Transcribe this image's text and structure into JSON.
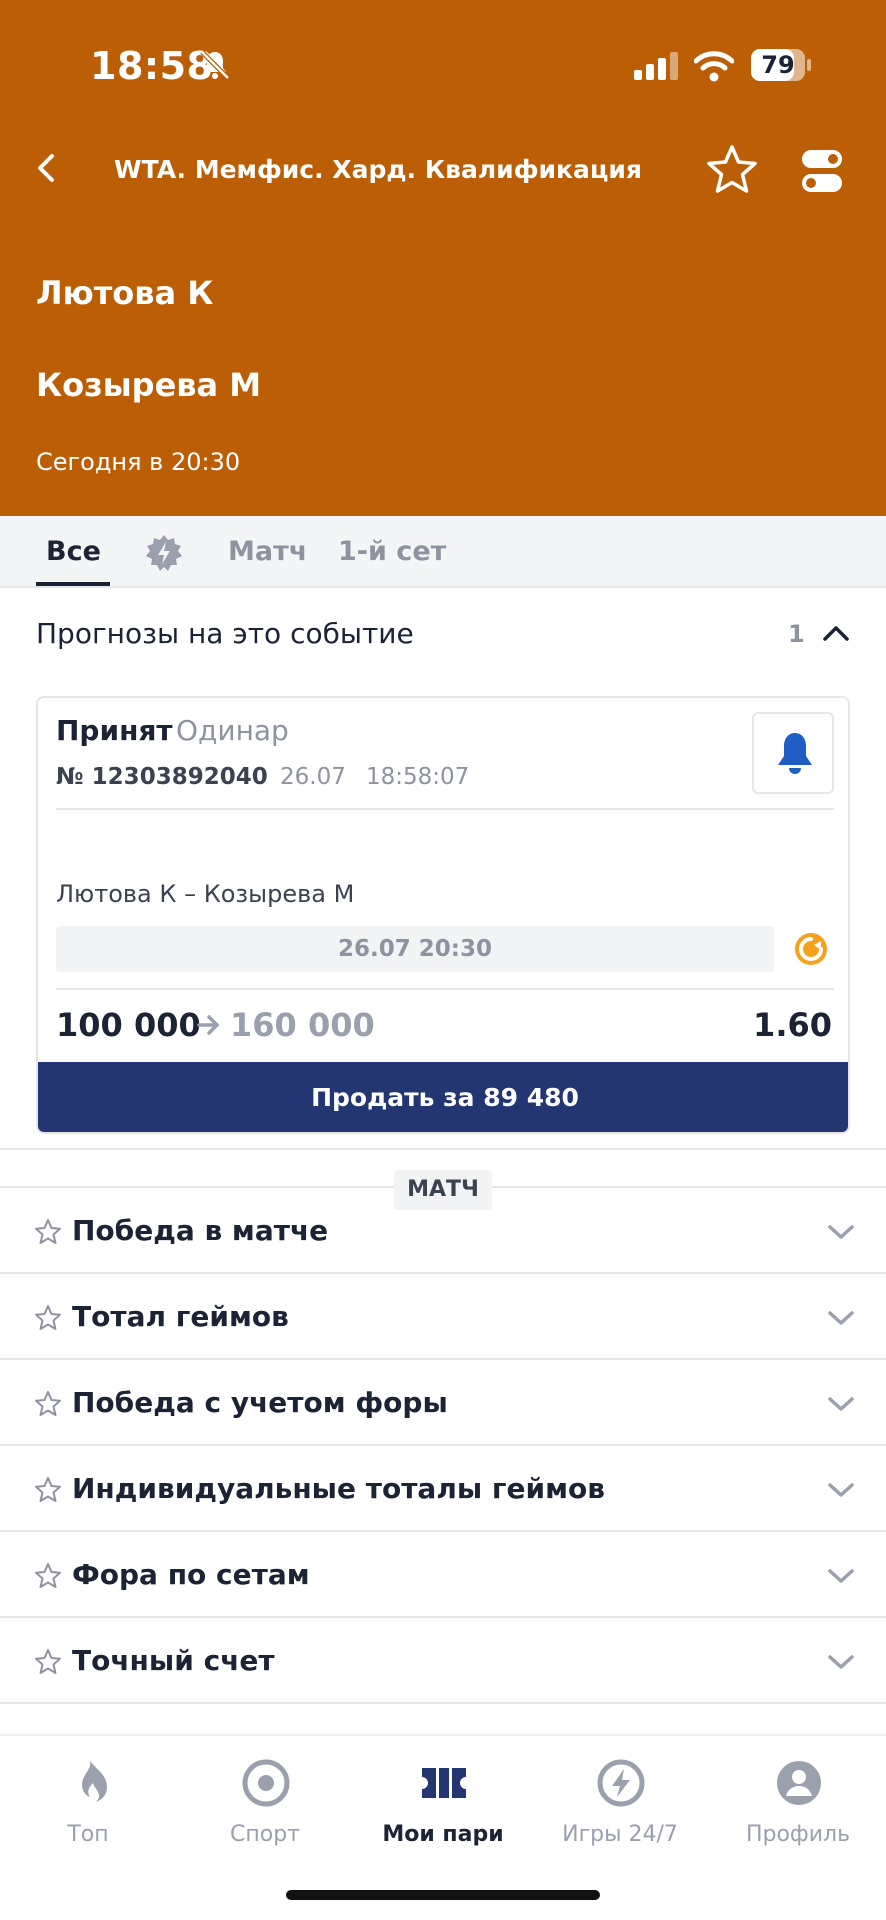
{
  "status_bar": {
    "time": "18:58",
    "battery": "79"
  },
  "header": {
    "title": "WTA. Мемфис. Хард. Квалификация",
    "player1": "Лютова К",
    "player2": "Козырева М",
    "event_time": "Сегодня в 20:30",
    "color": "#bb5e05"
  },
  "tabs": [
    {
      "label": "Все",
      "active": true
    },
    {
      "label": "Матч"
    },
    {
      "label": "1-й сет"
    }
  ],
  "predictions": {
    "title": "Прогнозы на это событие",
    "count": "1"
  },
  "bet": {
    "status": "Принят",
    "type": "Одинар",
    "number": "№ 12303892040",
    "date": "26.07",
    "time": "18:58:07",
    "match": "Лютова К – Козырева М",
    "event_datetime": "26.07 20:30",
    "stake": "100 000",
    "payout": "160 000",
    "odds": "1.60",
    "sell_label": "Продать за 89 480",
    "sell_color": "#243672"
  },
  "section_label": "МАТЧ",
  "markets": [
    "Победа в матче",
    "Тотал геймов",
    "Победа с учетом форы",
    "Индивидуальные тоталы геймов",
    "Фора по сетам",
    "Точный счет"
  ],
  "nav": [
    {
      "label": "Топ",
      "icon": "flame-icon"
    },
    {
      "label": "Спорт",
      "icon": "target-icon"
    },
    {
      "label": "Мои пари",
      "icon": "ticket-icon",
      "active": true
    },
    {
      "label": "Игры 24/7",
      "icon": "lightning-icon"
    },
    {
      "label": "Профиль",
      "icon": "user-icon"
    }
  ]
}
